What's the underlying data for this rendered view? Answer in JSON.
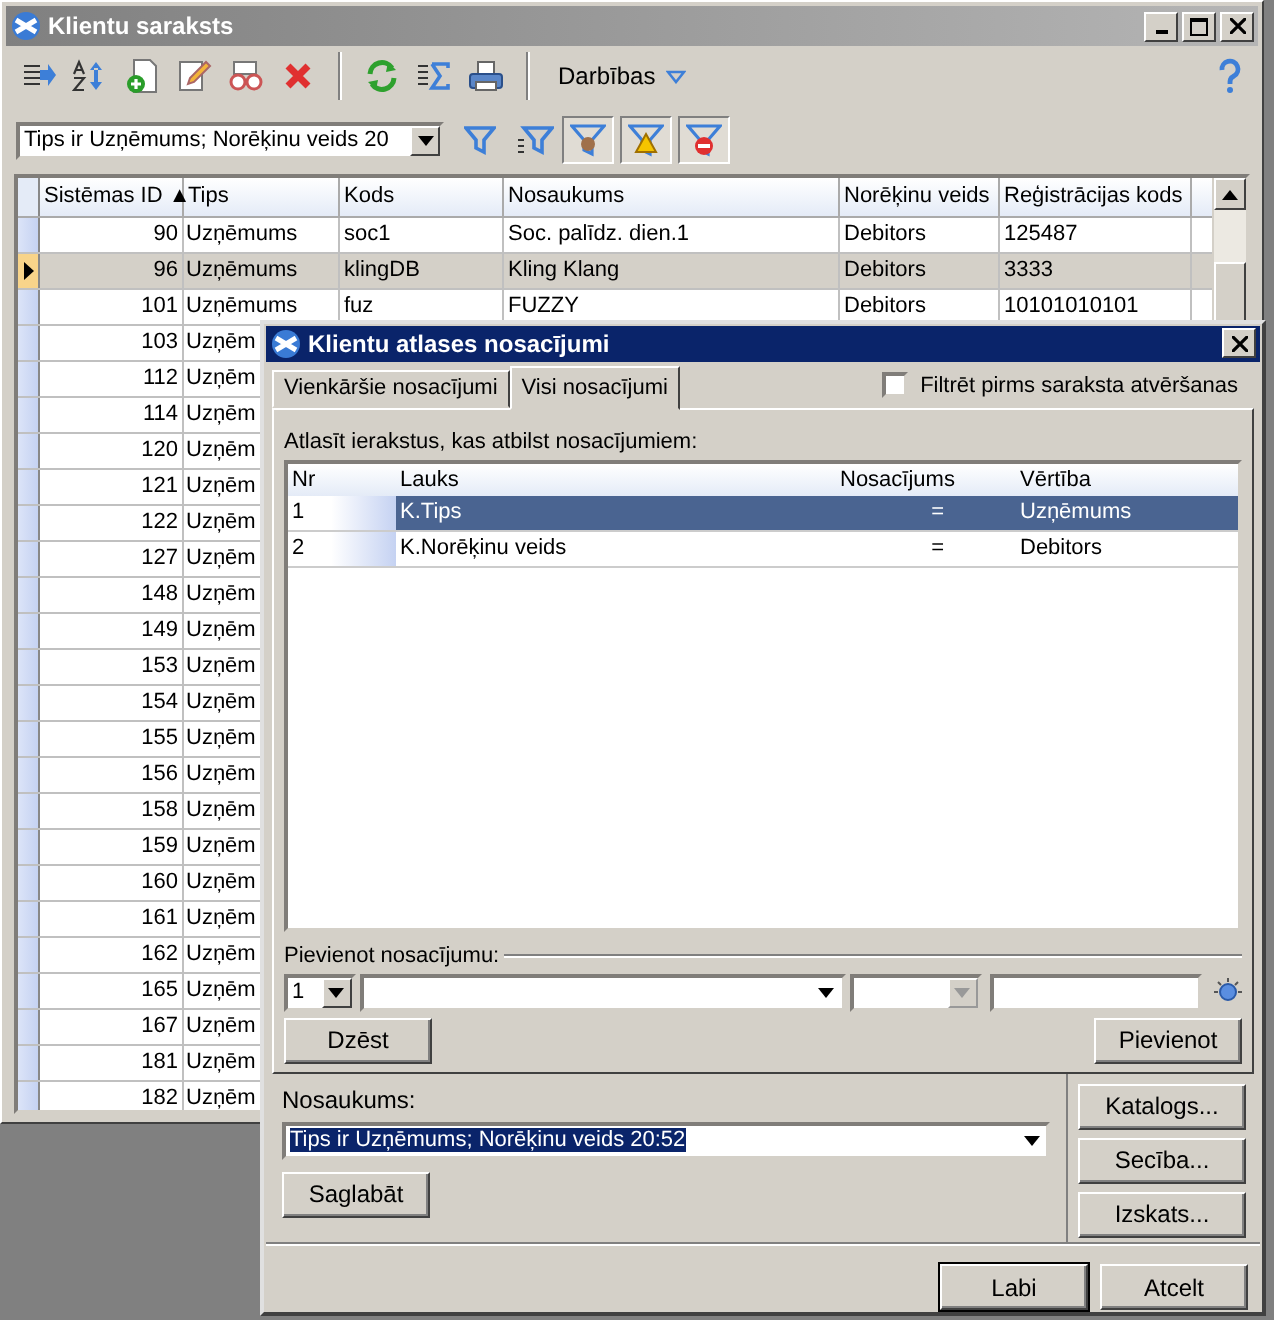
{
  "window": {
    "title": "Klientu saraksts"
  },
  "toolbar": {
    "menu": "Darbības"
  },
  "filter": {
    "value": "Tips ir Uzņēmums; Norēķinu veids  20"
  },
  "filter_toggles": [
    {
      "pressed": true
    },
    {
      "pressed": true
    },
    {
      "pressed": true
    }
  ],
  "table": {
    "columns": [
      "Sistēmas ID ▲",
      "Tips",
      "Kods",
      "Nosaukums",
      "Norēķinu veids",
      "Reģistrācijas kods"
    ],
    "rows": [
      {
        "cells": [
          "90",
          "Uzņēmums",
          "soc1",
          "Soc. palīdz. dien.1",
          "Debitors",
          "125487"
        ],
        "selected": false
      },
      {
        "cells": [
          "96",
          "Uzņēmums",
          "klingDB",
          "Kling Klang",
          "Debitors",
          "3333"
        ],
        "selected": true
      },
      {
        "cells": [
          "101",
          "Uzņēmums",
          "fuz",
          "FUZZY",
          "Debitors",
          "10101010101"
        ],
        "selected": false
      },
      {
        "cells": [
          "103",
          "Uzņēm"
        ],
        "selected": false
      },
      {
        "cells": [
          "112",
          "Uzņēm"
        ],
        "selected": false
      },
      {
        "cells": [
          "114",
          "Uzņēm"
        ],
        "selected": false
      },
      {
        "cells": [
          "120",
          "Uzņēm"
        ],
        "selected": false
      },
      {
        "cells": [
          "121",
          "Uzņēm"
        ],
        "selected": false
      },
      {
        "cells": [
          "122",
          "Uzņēm"
        ],
        "selected": false
      },
      {
        "cells": [
          "127",
          "Uzņēm"
        ],
        "selected": false
      },
      {
        "cells": [
          "148",
          "Uzņēm"
        ],
        "selected": false
      },
      {
        "cells": [
          "149",
          "Uzņēm"
        ],
        "selected": false
      },
      {
        "cells": [
          "153",
          "Uzņēm"
        ],
        "selected": false
      },
      {
        "cells": [
          "154",
          "Uzņēm"
        ],
        "selected": false
      },
      {
        "cells": [
          "155",
          "Uzņēm"
        ],
        "selected": false
      },
      {
        "cells": [
          "156",
          "Uzņēm"
        ],
        "selected": false
      },
      {
        "cells": [
          "158",
          "Uzņēm"
        ],
        "selected": false
      },
      {
        "cells": [
          "159",
          "Uzņēm"
        ],
        "selected": false
      },
      {
        "cells": [
          "160",
          "Uzņēm"
        ],
        "selected": false
      },
      {
        "cells": [
          "161",
          "Uzņēm"
        ],
        "selected": false
      },
      {
        "cells": [
          "162",
          "Uzņēm"
        ],
        "selected": false
      },
      {
        "cells": [
          "165",
          "Uzņēm"
        ],
        "selected": false
      },
      {
        "cells": [
          "167",
          "Uzņēm"
        ],
        "selected": false
      },
      {
        "cells": [
          "181",
          "Uzņēm"
        ],
        "selected": false
      },
      {
        "cells": [
          "182",
          "Uzņēm"
        ],
        "selected": false
      }
    ]
  },
  "dialog": {
    "title": "Klientu atlases nosacījumi",
    "tabs": [
      {
        "label": "Vienkāršie nosacījumi",
        "selected": false
      },
      {
        "label": "Visi nosacījumi",
        "selected": true
      }
    ],
    "prefilter": {
      "label": "Filtrēt pirms saraksta atvēršanas",
      "checked": false
    },
    "intro": "Atlasīt ierakstus, kas atbilst nosacījumiem:",
    "grid": {
      "columns": [
        "Nr",
        "Lauks",
        "Nosacījums",
        "Vērtība"
      ],
      "rows": [
        {
          "nr": "1",
          "field": "K.Tips",
          "condition": "=",
          "value": "Uzņēmums",
          "selected": true
        },
        {
          "nr": "2",
          "field": "K.Norēķinu veids",
          "condition": "=",
          "value": "Debitors",
          "selected": false
        }
      ]
    },
    "add_group": "Pievienot nosacījumu:",
    "add_index": "1",
    "delete_button": "Dzēst",
    "add_button": "Pievienot",
    "name_label": "Nosaukums:",
    "name_value": "Tips ir Uzņēmums; Norēķinu veids  20:52",
    "save_button": "Saglabāt",
    "side_buttons": [
      "Katalogs...",
      "Secība...",
      "Izskats..."
    ],
    "ok_button": "Labi",
    "cancel_button": "Atcelt"
  }
}
